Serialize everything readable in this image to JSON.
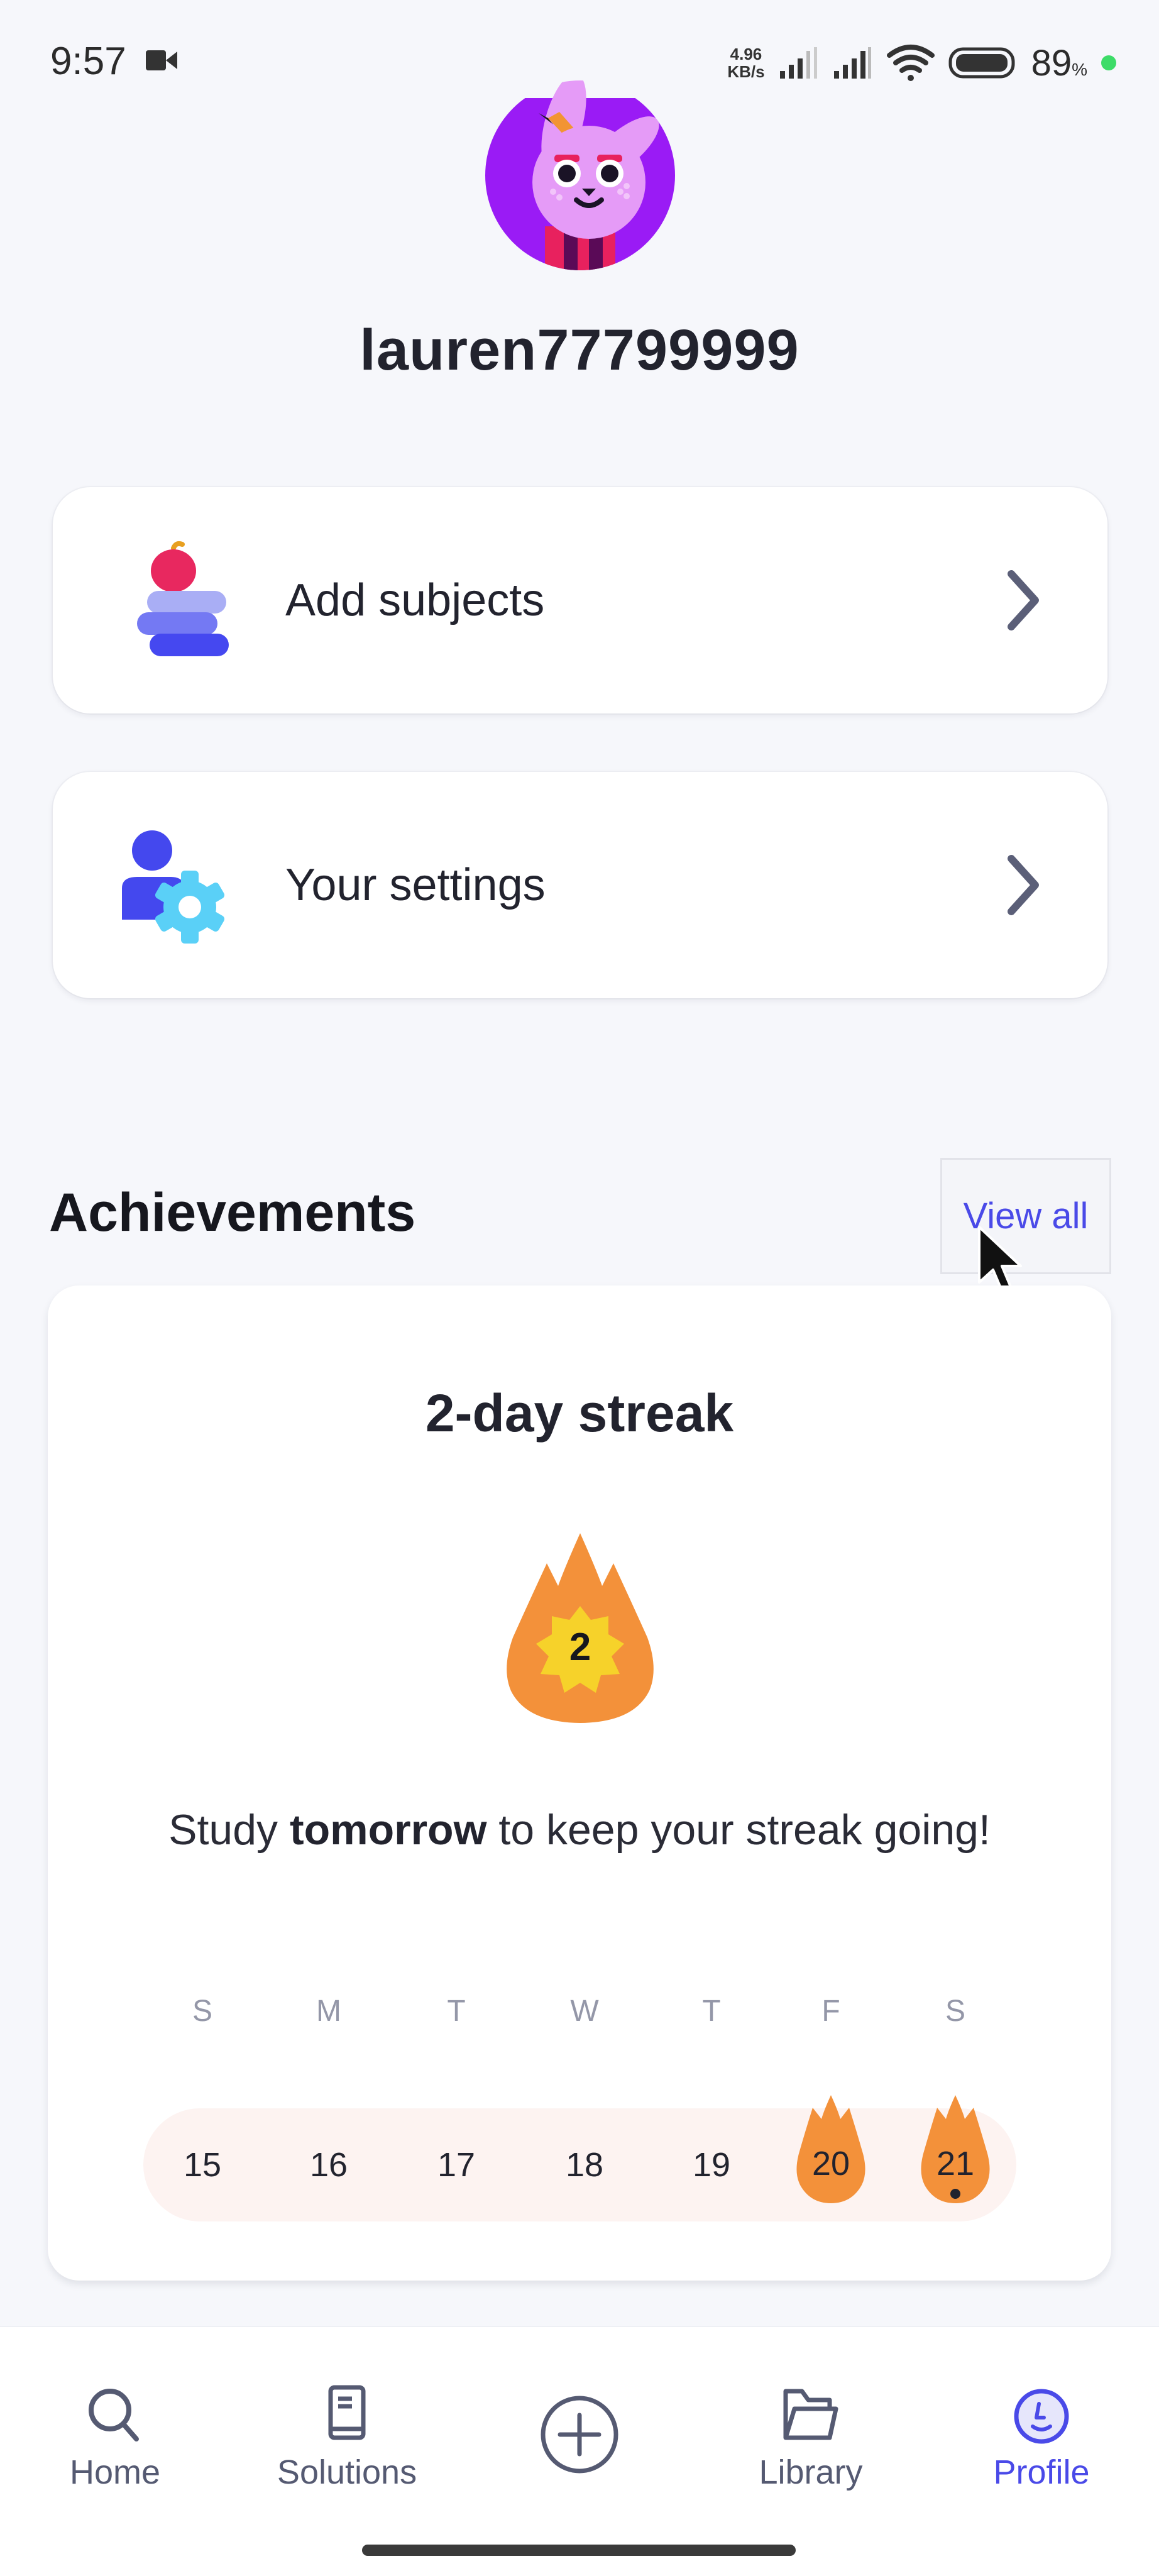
{
  "status_bar": {
    "time": "9:57",
    "net_speed_value": "4.96",
    "net_speed_unit": "KB/s",
    "battery_percent": "89",
    "battery_suffix": "%",
    "icons": [
      "video-camera-icon",
      "signal-icon",
      "signal-icon",
      "wifi-icon",
      "battery-icon"
    ]
  },
  "profile": {
    "username": "lauren77799999",
    "avatar": "bunny-avatar"
  },
  "menu": [
    {
      "label": "Add subjects",
      "icon": "subjects-stack-icon"
    },
    {
      "label": "Your settings",
      "icon": "user-settings-icon"
    }
  ],
  "achievements": {
    "title": "Achievements",
    "view_all": "View all",
    "streak": {
      "title": "2-day streak",
      "count": "2",
      "message_pre": "Study ",
      "message_bold": "tomorrow",
      "message_post": " to keep your streak going!",
      "weekday_labels": [
        "S",
        "M",
        "T",
        "W",
        "T",
        "F",
        "S"
      ],
      "days": [
        {
          "date": "15",
          "streak": false,
          "today": false
        },
        {
          "date": "16",
          "streak": false,
          "today": false
        },
        {
          "date": "17",
          "streak": false,
          "today": false
        },
        {
          "date": "18",
          "streak": false,
          "today": false
        },
        {
          "date": "19",
          "streak": false,
          "today": false
        },
        {
          "date": "20",
          "streak": true,
          "today": false
        },
        {
          "date": "21",
          "streak": true,
          "today": true
        }
      ]
    }
  },
  "bottom_nav": {
    "items": [
      {
        "label": "Home",
        "icon": "search-icon",
        "active": false
      },
      {
        "label": "Solutions",
        "icon": "book-icon",
        "active": false
      },
      {
        "label": "",
        "icon": "plus-circle-icon",
        "active": false
      },
      {
        "label": "Library",
        "icon": "folder-icon",
        "active": false
      },
      {
        "label": "Profile",
        "icon": "profile-avatar-icon",
        "active": true
      }
    ]
  },
  "colors": {
    "accent": "#4A4AE8",
    "background": "#F6F7FB",
    "streak_orange": "#F3913A",
    "streak_yellow": "#F6D22A",
    "strip_bg": "#FDF3F1",
    "avatar_bg": "#9A1BF5"
  }
}
